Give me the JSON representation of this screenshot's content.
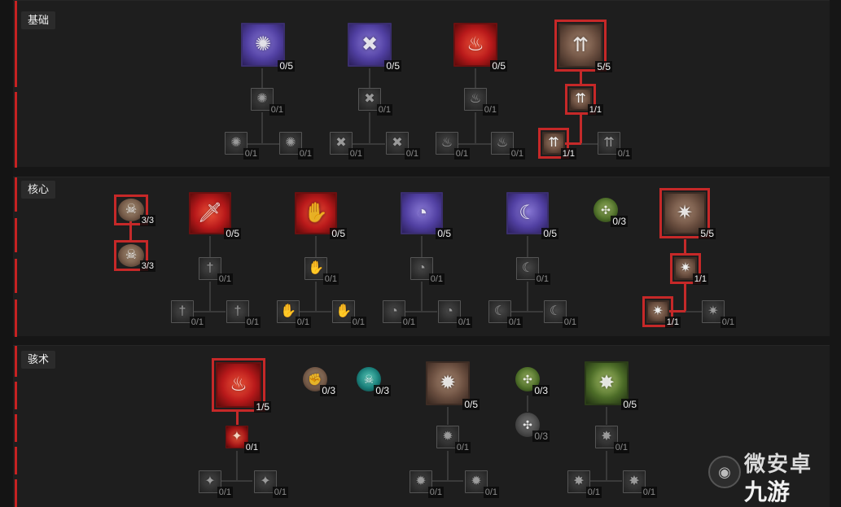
{
  "sections": [
    {
      "label": "基础"
    },
    {
      "label": "核心"
    },
    {
      "label": "骇术"
    }
  ],
  "nodes": {
    "s1_a": "0/5",
    "s1_a1": "0/1",
    "s1_a2": "0/1",
    "s1_a3": "0/1",
    "s1_b": "0/5",
    "s1_b1": "0/1",
    "s1_b2": "0/1",
    "s1_b3": "0/1",
    "s1_c": "0/5",
    "s1_c1": "0/1",
    "s1_c2": "0/1",
    "s1_c3": "0/1",
    "s1_d": "5/5",
    "s1_d1": "1/1",
    "s1_d2": "1/1",
    "s1_d3": "0/1",
    "s2_p1": "3/3",
    "s2_p2": "3/3",
    "s2_a": "0/5",
    "s2_a1": "0/1",
    "s2_a2": "0/1",
    "s2_a3": "0/1",
    "s2_b": "0/5",
    "s2_b1": "0/1",
    "s2_b2": "0/1",
    "s2_b3": "0/1",
    "s2_c": "0/5",
    "s2_c1": "0/1",
    "s2_c2": "0/1",
    "s2_c3": "0/1",
    "s2_d": "0/5",
    "s2_d1": "0/1",
    "s2_d2": "0/1",
    "s2_d3": "0/1",
    "s2_g": "0/3",
    "s2_e": "5/5",
    "s2_e1": "1/1",
    "s2_e2": "1/1",
    "s2_e3": "0/1",
    "s3_a": "1/5",
    "s3_a1": "0/1",
    "s3_a2": "0/1",
    "s3_a3": "0/1",
    "s3_p1": "0/3",
    "s3_p2": "0/3",
    "s3_b": "0/5",
    "s3_b1": "0/1",
    "s3_b2": "0/1",
    "s3_b3": "0/1",
    "s3_p3": "0/3",
    "s3_p4": "0/3",
    "s3_c": "0/5",
    "s3_c1": "0/1",
    "s3_c2": "0/1",
    "s3_c3": "0/1"
  },
  "watermark": {
    "text": "微安卓",
    "logo": "九游"
  },
  "colors": {
    "accent_red": "#c62828",
    "panel": "#1e1e1e",
    "connector": "#3a3a3a"
  },
  "icons": {
    "large": [
      "thorn-fist-icon",
      "bone-cross-icon",
      "flame-hand-icon",
      "arrow-volley-icon",
      "blood-dagger-icon",
      "fire-sigil-icon",
      "scythe-orb-icon",
      "scythe-claw-icon",
      "spear-burst-icon",
      "blood-nova-icon",
      "thorn-ring-icon",
      "bone-spike-icon"
    ],
    "round": [
      "skull-shield-icon",
      "earth-fist-icon",
      "spirit-wisp-icon",
      "poison-rune-icon",
      "gray-rune-icon"
    ]
  }
}
